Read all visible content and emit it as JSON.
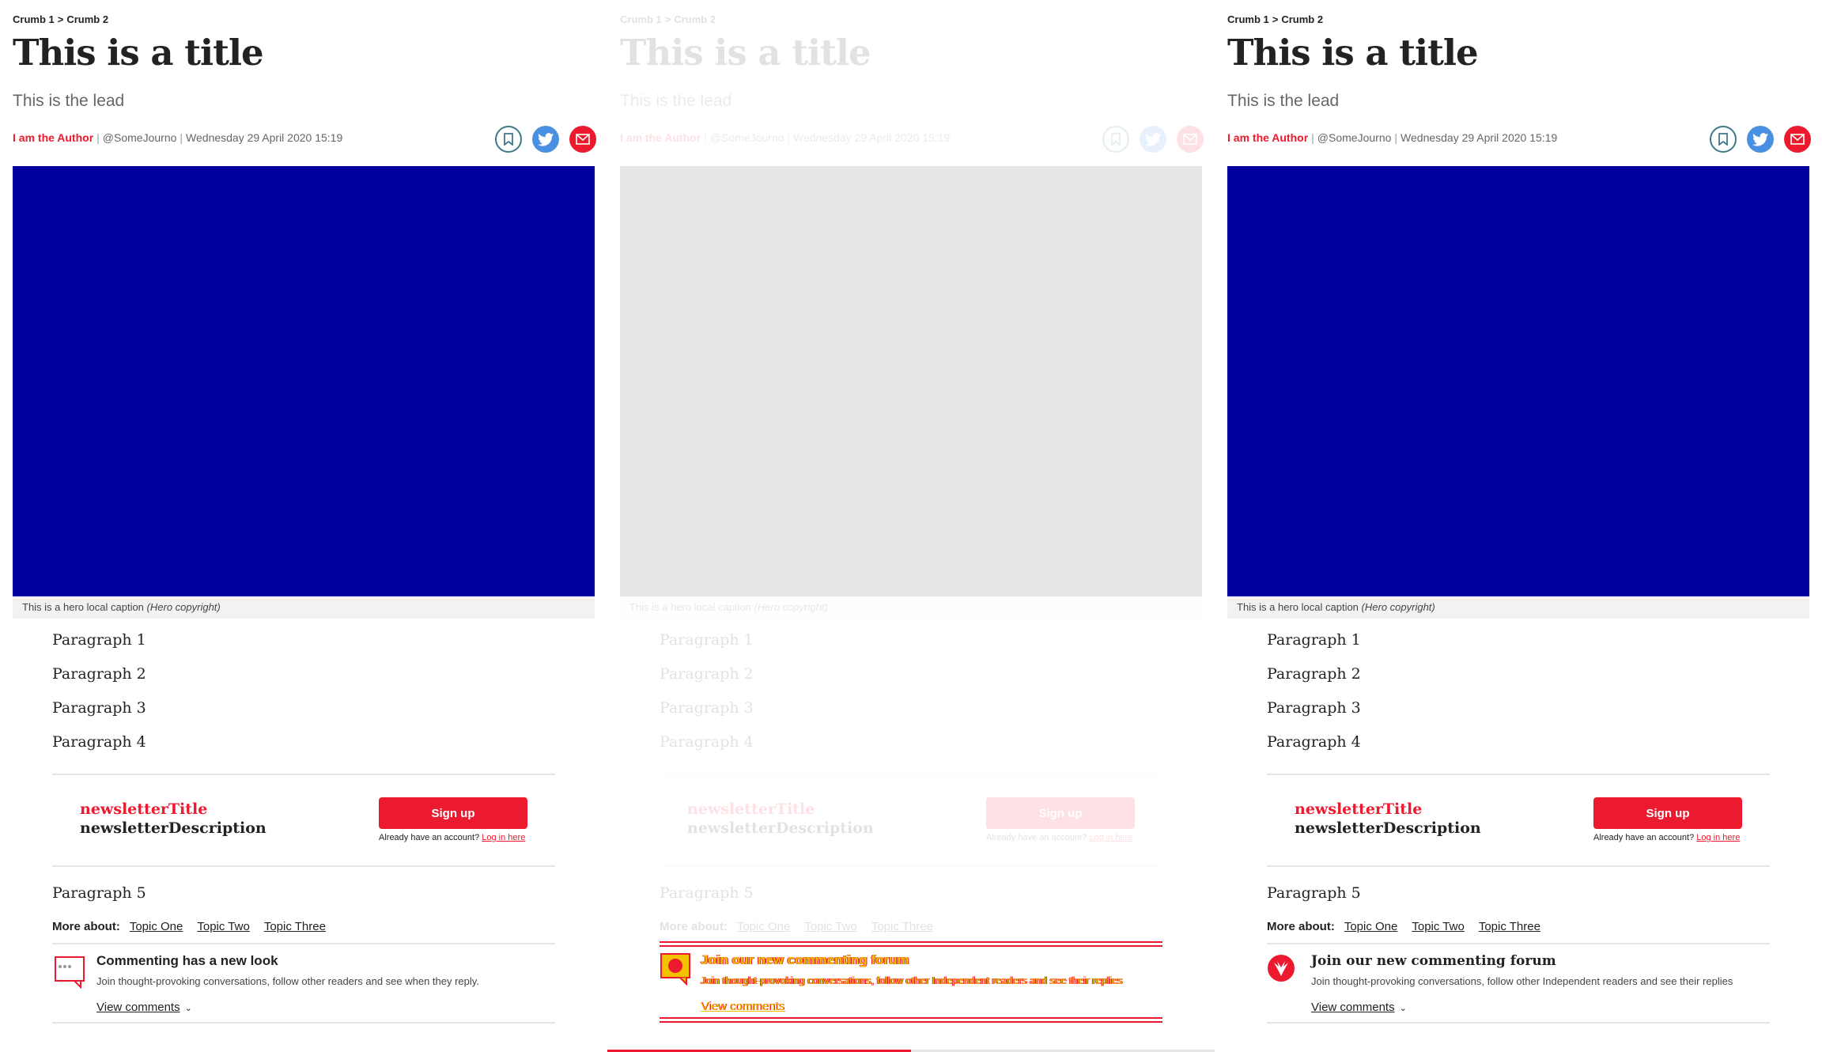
{
  "article": {
    "breadcrumb": {
      "crumb1": "Crumb 1",
      "separator": ">",
      "crumb2": "Crumb 2"
    },
    "title": "This is a title",
    "lead": "This is the lead",
    "byline": {
      "author": "I am the Author",
      "handle": "@SomeJourno",
      "date": "Wednesday 29 April 2020 15:19",
      "separator": "|"
    },
    "share": {
      "icons": [
        "bookmark-icon",
        "twitter-icon",
        "email-icon"
      ]
    },
    "hero": {
      "caption": "This is a hero local caption",
      "copyright": "(Hero copyright)"
    },
    "paragraphs": [
      "Paragraph 1",
      "Paragraph 2",
      "Paragraph 3",
      "Paragraph 4"
    ],
    "newsletter": {
      "title": "newsletterTitle",
      "description": "newsletterDescription",
      "signup_label": "Sign up",
      "already": "Already have an account?",
      "login_label": "Log in here"
    },
    "paragraph5": "Paragraph 5",
    "more_about": {
      "label": "More about:",
      "topics": [
        "Topic One",
        "Topic Two",
        "Topic Three"
      ]
    }
  },
  "comments_panel1": {
    "title": "Commenting has a new look",
    "description": "Join thought-provoking conversations, follow other readers and see when they reply.",
    "view_label": "View comments"
  },
  "comments_panel3": {
    "title": "Join our new commenting forum",
    "description": "Join thought-provoking conversations, follow other Independent readers and see their replies",
    "view_label": "View comments"
  },
  "scroll_progress": 0.5,
  "colors": {
    "brand_red": "#ec1a2e",
    "hero_blue": "#00009c",
    "twitter_blue": "#4a90e2",
    "glitch_yellow": "#f2c200"
  }
}
